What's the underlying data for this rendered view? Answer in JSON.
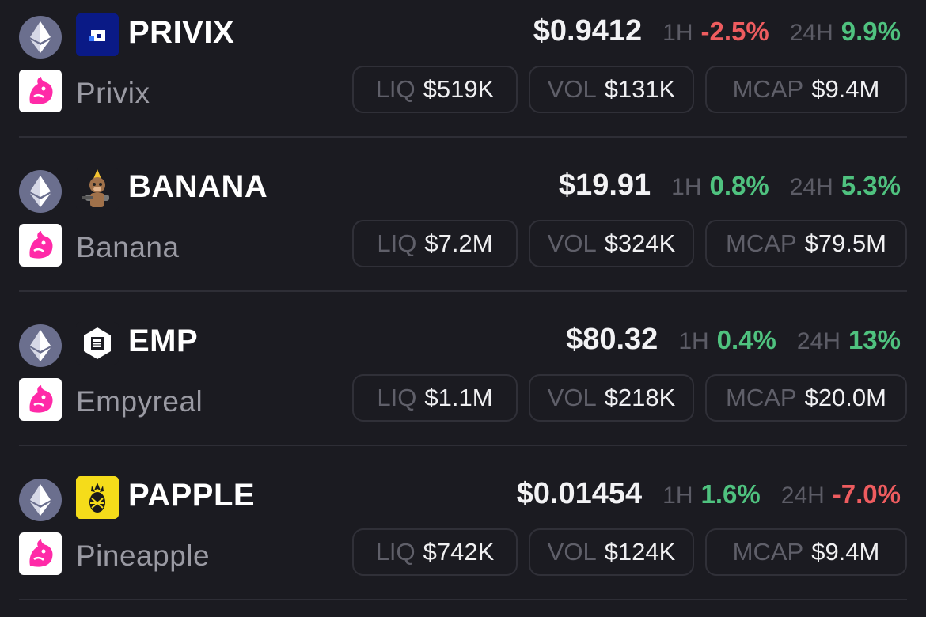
{
  "tokens": [
    {
      "symbol": "PRIVIX",
      "name": "Privix",
      "price": "$0.9412",
      "h1_label": "1H",
      "h1": "-2.5%",
      "h24_label": "24H",
      "h24": "9.9%",
      "liq_label": "LIQ",
      "liq": "$519K",
      "vol_label": "VOL",
      "vol": "$131K",
      "mcap_label": "MCAP",
      "mcap": "$9.4M",
      "icon": "privix-logo-icon"
    },
    {
      "symbol": "BANANA",
      "name": "Banana",
      "price": "$19.91",
      "h1_label": "1H",
      "h1": "0.8%",
      "h24_label": "24H",
      "h24": "5.3%",
      "liq_label": "LIQ",
      "liq": "$7.2M",
      "vol_label": "VOL",
      "vol": "$324K",
      "mcap_label": "MCAP",
      "mcap": "$79.5M",
      "icon": "banana-monkey-icon"
    },
    {
      "symbol": "EMP",
      "name": "Empyreal",
      "price": "$80.32",
      "h1_label": "1H",
      "h1": "0.4%",
      "h24_label": "24H",
      "h24": "13%",
      "liq_label": "LIQ",
      "liq": "$1.1M",
      "vol_label": "VOL",
      "vol": "$218K",
      "mcap_label": "MCAP",
      "mcap": "$20.0M",
      "icon": "empyreal-hexagon-icon"
    },
    {
      "symbol": "PAPPLE",
      "name": "Pineapple",
      "price": "$0.01454",
      "h1_label": "1H",
      "h1": "1.6%",
      "h24_label": "24H",
      "h24": "-7.0%",
      "liq_label": "LIQ",
      "liq": "$742K",
      "vol_label": "VOL",
      "vol": "$124K",
      "mcap_label": "MCAP",
      "mcap": "$9.4M",
      "icon": "pineapple-icon"
    }
  ],
  "chain_icon": "ethereum-icon",
  "dex_icon": "uniswap-unicorn-icon",
  "colors": {
    "background": "#1b1b21",
    "positive": "#4fc27f",
    "negative": "#ee5c5f",
    "muted": "#5c5c66"
  }
}
